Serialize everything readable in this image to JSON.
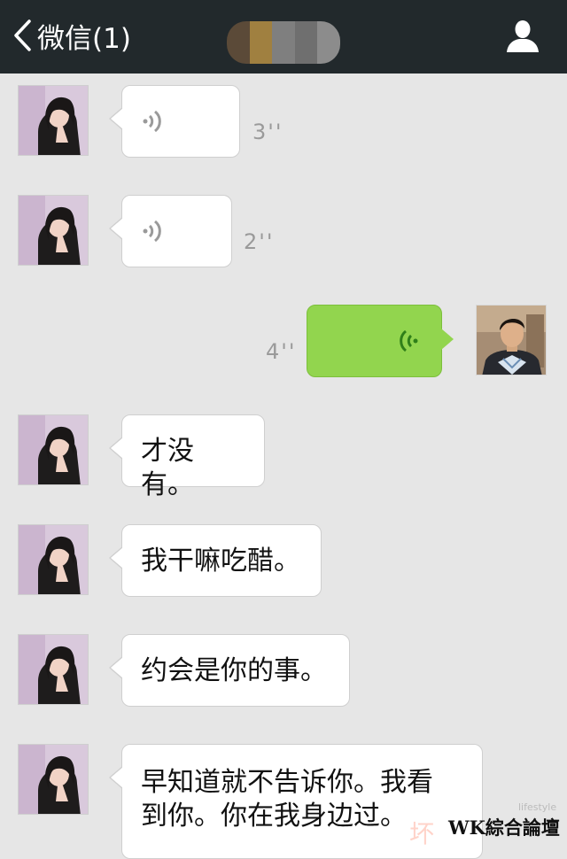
{
  "header": {
    "back_label": "微信(1)",
    "mosaic_colors": [
      "#6e5c46",
      "#a08040",
      "#8a8a8a",
      "#7b7b7b",
      "#9a9a9a"
    ]
  },
  "messages": [
    {
      "side": "left",
      "type": "voice",
      "duration": "3''"
    },
    {
      "side": "left",
      "type": "voice",
      "duration": "2''"
    },
    {
      "side": "right",
      "type": "voice",
      "duration": "4''"
    },
    {
      "side": "left",
      "type": "text",
      "text": "才没有。"
    },
    {
      "side": "left",
      "type": "text",
      "text": "我干嘛吃醋。"
    },
    {
      "side": "left",
      "type": "text",
      "text": "约会是你的事。"
    },
    {
      "side": "left",
      "type": "text",
      "text": "早知道就不告诉你。我看\n到你。你在我身边过。"
    }
  ],
  "watermark": {
    "main": "WK綜合論壇",
    "faint": "坏",
    "small": "lifestyle"
  },
  "colors": {
    "header_bg": "#22292c",
    "chat_bg": "#e6e6e6",
    "bubble_in": "#ffffff",
    "bubble_out": "#92d54e"
  }
}
